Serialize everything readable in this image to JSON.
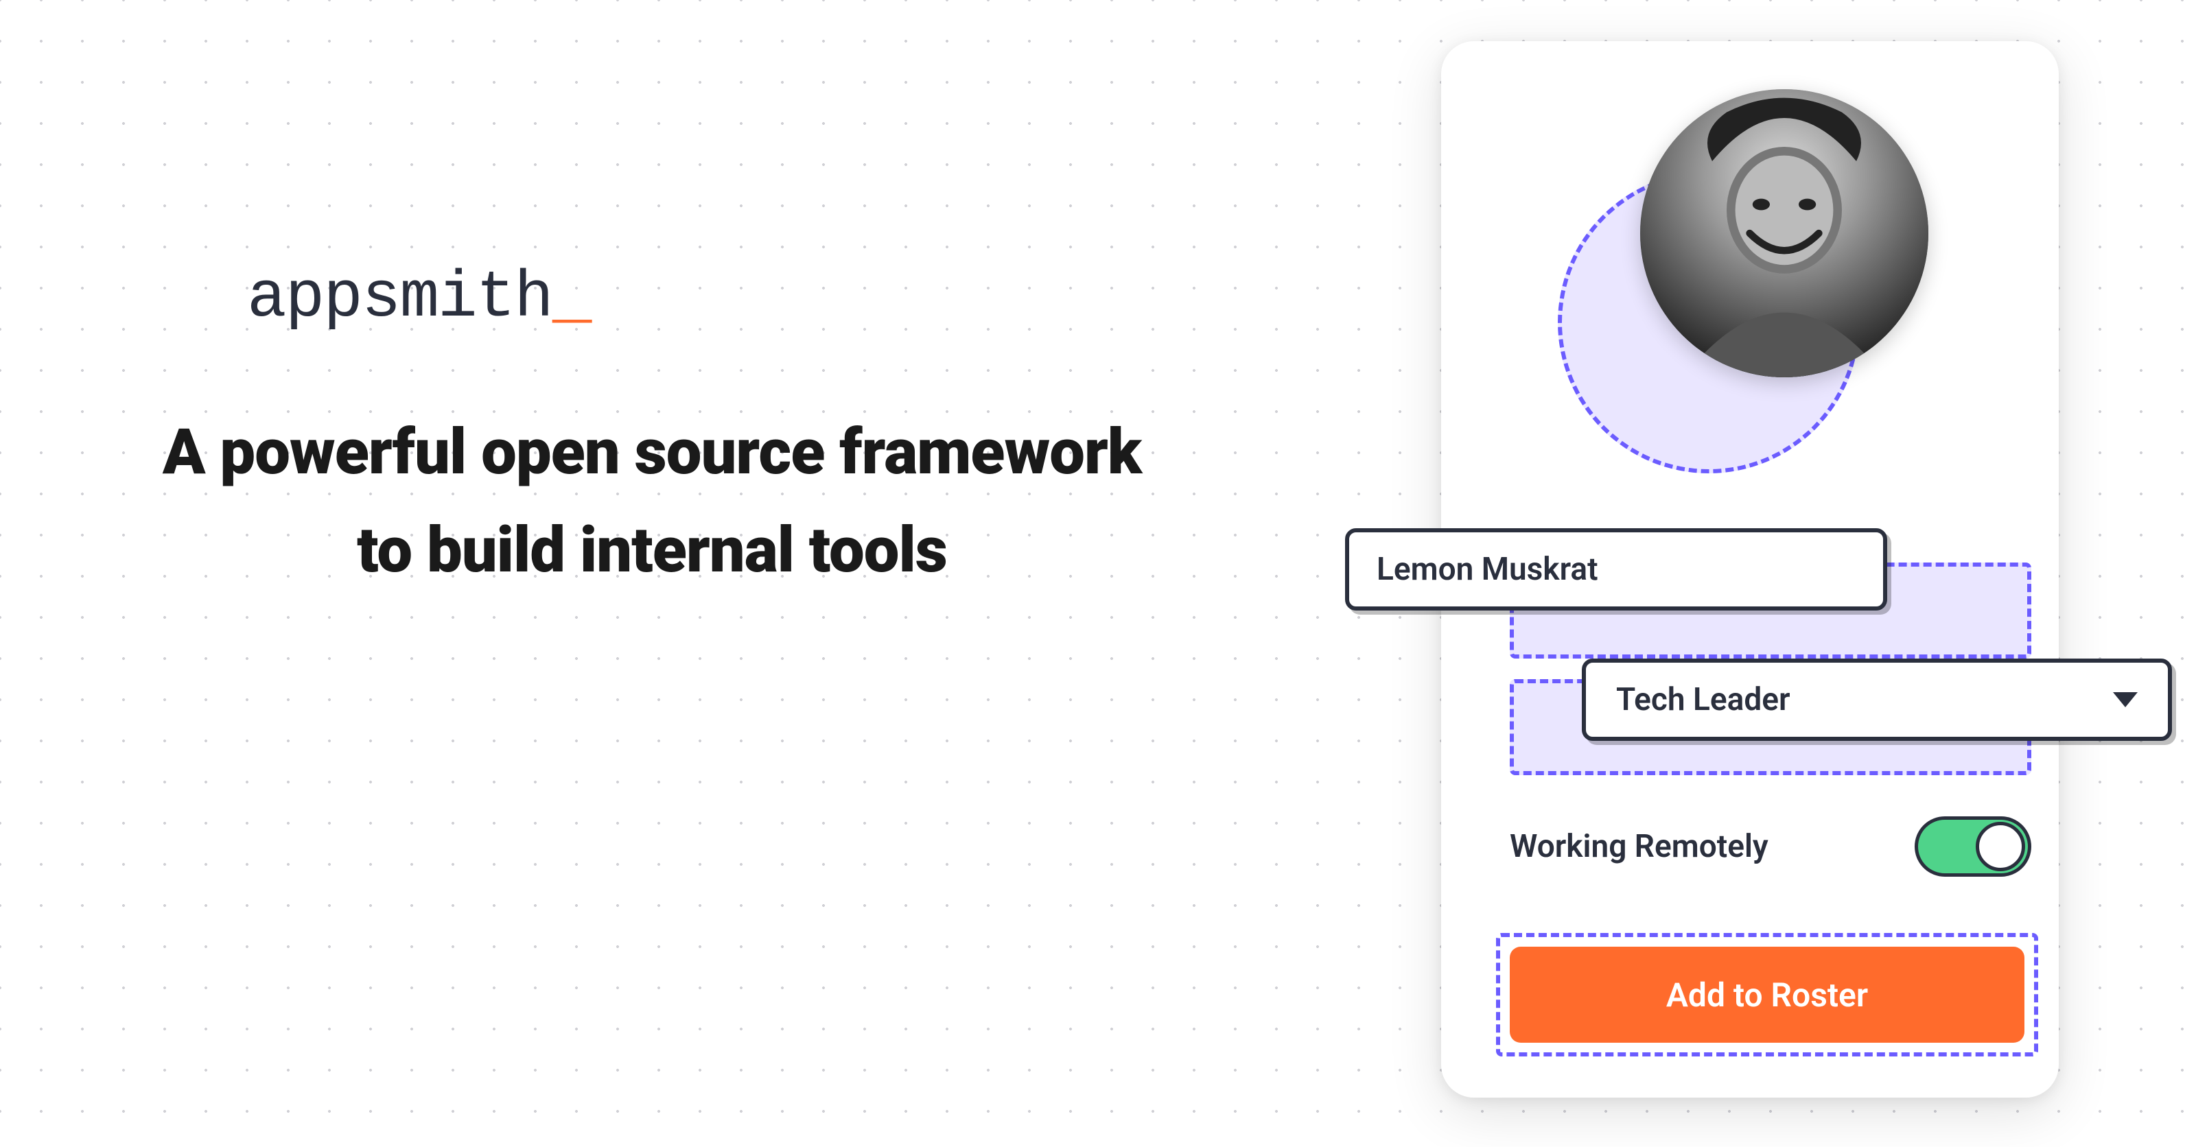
{
  "brand": {
    "name": "appsmith",
    "cursor": "_"
  },
  "tagline": "A powerful open source framework to build internal tools",
  "form": {
    "name_value": "Lemon Muskrat",
    "role_value": "Tech Leader",
    "toggle_label": "Working Remotely",
    "toggle_on": true,
    "submit_label": "Add to Roster"
  },
  "colors": {
    "accent_orange": "#ff6b2c",
    "accent_purple": "#6b5cff",
    "toggle_green": "#4fd38a",
    "text_dark": "#2a2f3d"
  }
}
